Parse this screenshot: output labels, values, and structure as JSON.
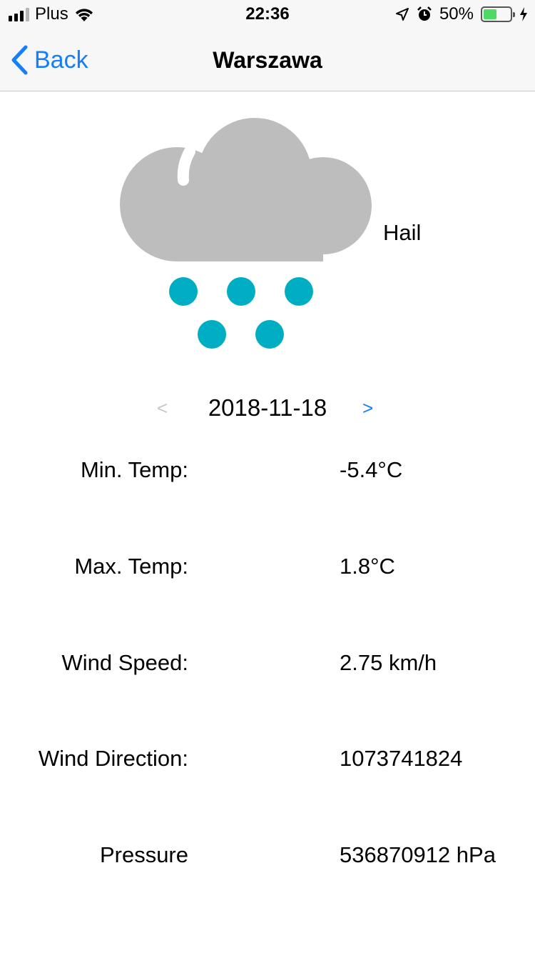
{
  "status_bar": {
    "carrier": "Plus",
    "time": "22:36",
    "battery": "50%",
    "battery_level": 0.5,
    "icons": [
      "signal-icon",
      "wifi-icon",
      "location-icon",
      "alarm-icon",
      "battery-icon",
      "charging-icon"
    ]
  },
  "nav": {
    "back_label": "Back",
    "title": "Warszawa"
  },
  "weather": {
    "icon": "hail-icon",
    "condition": "Hail",
    "colors": {
      "cloud": "#bdbdbd",
      "hail": "#00aec3"
    }
  },
  "date_selector": {
    "prev": "<",
    "date": "2018-11-18",
    "next": ">"
  },
  "stats": [
    {
      "label": "Min. Temp:",
      "value": "-5.4°C"
    },
    {
      "label": "Max. Temp:",
      "value": "1.8°C"
    },
    {
      "label": "Wind Speed:",
      "value": "2.75 km/h"
    },
    {
      "label": "Wind Direction:",
      "value": "1073741824"
    },
    {
      "label": "Pressure",
      "value": "536870912 hPa"
    }
  ],
  "colors": {
    "accent": "#147efb",
    "disabled": "#c7c7cc"
  }
}
